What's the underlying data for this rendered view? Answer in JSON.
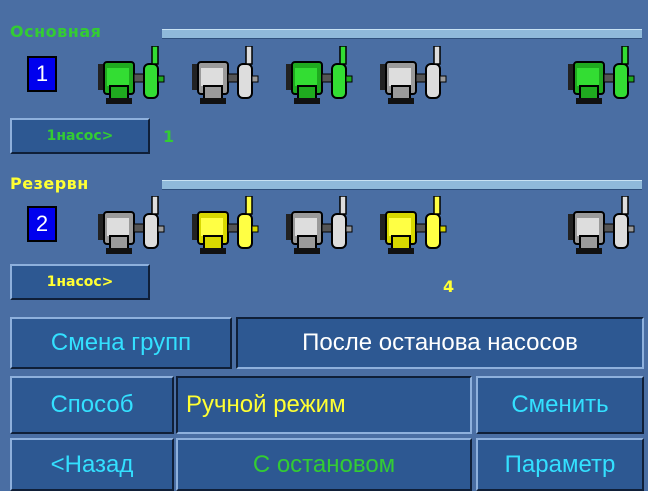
{
  "colors": {
    "green": "#33cc33",
    "yellow": "#ffff33",
    "cyan": "#33e0ff",
    "white": "#ffffff",
    "panel": "#2d5892",
    "background": "#4a6ea3"
  },
  "groups": [
    {
      "title": "Основная",
      "number": "1",
      "button": "1насос>",
      "value": "1",
      "title_color": "#33cc33",
      "value_color": "#33cc33",
      "pumps": [
        "green",
        "grey",
        "green",
        "grey",
        "green"
      ]
    },
    {
      "title": "Резервн",
      "number": "2",
      "button": "1насос>",
      "value": "4",
      "title_color": "#ffff33",
      "value_color": "#ffff33",
      "pumps": [
        "grey",
        "yellow",
        "grey",
        "yellow",
        "grey"
      ]
    }
  ],
  "change_groups": {
    "label": "Смена групп",
    "value": "После останова насосов"
  },
  "method": {
    "label": "Способ",
    "value": "Ручной режим",
    "action": "Сменить"
  },
  "footer": {
    "back": "<Назад",
    "stop_mode": "С остановом",
    "params": "Параметр"
  }
}
